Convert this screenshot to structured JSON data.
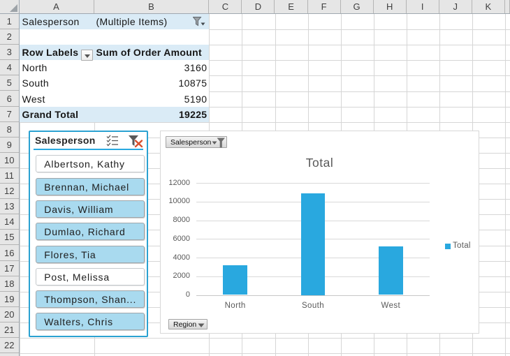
{
  "sheet": {
    "column_letters": [
      "A",
      "B",
      "C",
      "D",
      "E",
      "F",
      "G",
      "H",
      "I",
      "J",
      "K"
    ],
    "row_numbers": [
      "1",
      "2",
      "3",
      "4",
      "5",
      "6",
      "7",
      "8",
      "9",
      "10",
      "11",
      "12",
      "13",
      "14",
      "15",
      "16",
      "17",
      "18",
      "19",
      "20",
      "21",
      "22"
    ]
  },
  "pivot": {
    "filter_field": "Salesperson",
    "filter_value": "(Multiple Items)",
    "row_header": "Row Labels",
    "value_header": "Sum of Order Amount",
    "rows": [
      {
        "label": "North",
        "value": "3160"
      },
      {
        "label": "South",
        "value": "10875"
      },
      {
        "label": "West",
        "value": "5190"
      }
    ],
    "total_label": "Grand Total",
    "total_value": "19225"
  },
  "slicer": {
    "title": "Salesperson",
    "items": [
      {
        "label": "Albertson, Kathy",
        "selected": false
      },
      {
        "label": "Brennan, Michael",
        "selected": true
      },
      {
        "label": "Davis, William",
        "selected": true
      },
      {
        "label": "Dumlao, Richard",
        "selected": true
      },
      {
        "label": "Flores, Tia",
        "selected": true
      },
      {
        "label": "Post, Melissa",
        "selected": false
      },
      {
        "label": "Thompson, Shan...",
        "selected": true
      },
      {
        "label": "Walters, Chris",
        "selected": true
      }
    ]
  },
  "chart": {
    "filter_button_label": "Salesperson",
    "axis_button_label": "Region",
    "legend_label": "Total"
  },
  "chart_data": {
    "type": "bar",
    "title": "Total",
    "categories": [
      "North",
      "South",
      "West"
    ],
    "series": [
      {
        "name": "Total",
        "values": [
          3160,
          10875,
          5190
        ]
      }
    ],
    "ylim": [
      0,
      12000
    ],
    "yticks": [
      0,
      2000,
      4000,
      6000,
      8000,
      10000,
      12000
    ],
    "grid": true,
    "legend_position": "right"
  },
  "colors": {
    "accent_bar": "#29A8DF",
    "pivot_fill": "#DAEBF6",
    "slicer_border": "#2BA2D1",
    "slicer_selected_fill": "#A9DAEF",
    "chart_text": "#595959",
    "clear_filter_x": "#D9502C"
  }
}
